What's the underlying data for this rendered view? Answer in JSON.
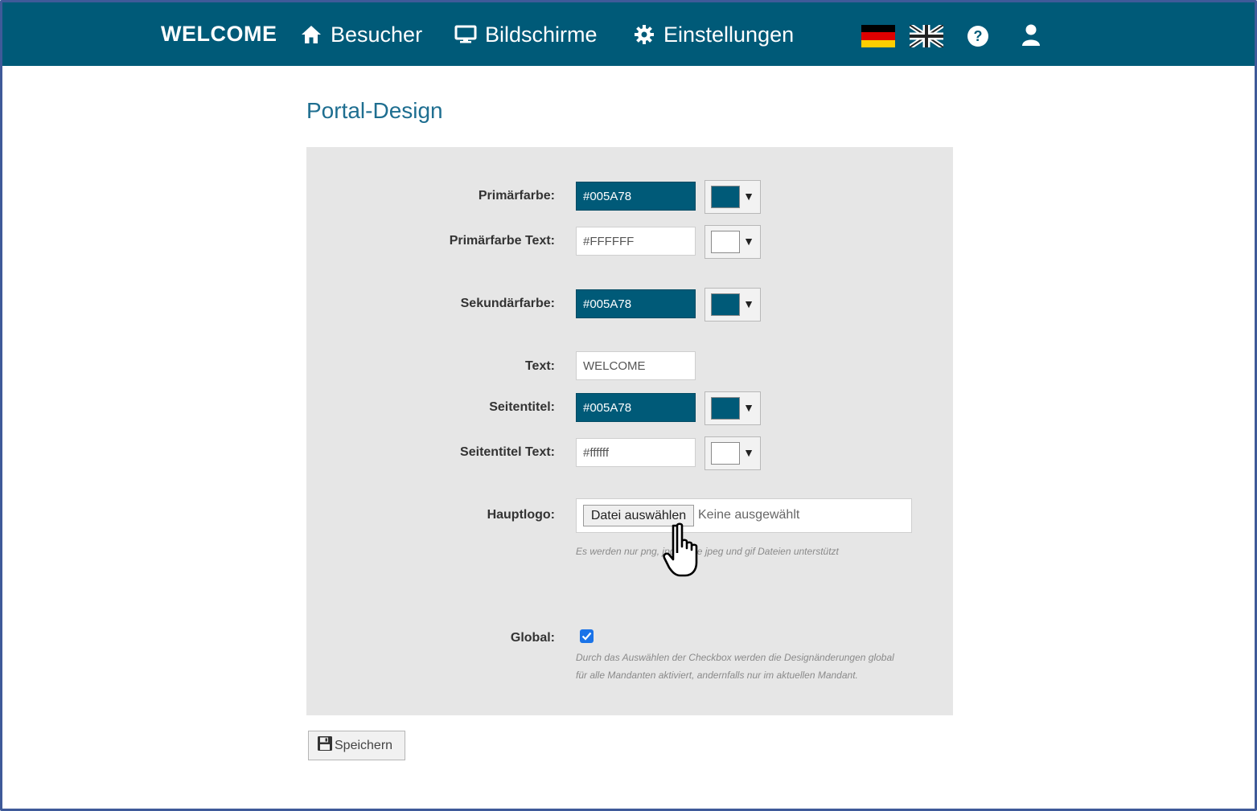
{
  "navbar": {
    "brand": "WELCOME",
    "items": [
      {
        "label": "Besucher",
        "icon": "home-icon"
      },
      {
        "label": "Bildschirme",
        "icon": "monitor-icon"
      },
      {
        "label": "Einstellungen",
        "icon": "gear-icon"
      }
    ],
    "languages": [
      "flag-de-icon",
      "flag-uk-icon"
    ],
    "help_icon": "help-icon",
    "user_icon": "user-icon",
    "bar_color": "#005A78"
  },
  "page": {
    "title": "Portal-Design"
  },
  "form": {
    "primary": {
      "label": "Primärfarbe:",
      "value": "#005A78",
      "swatch": "#005A78"
    },
    "primary_text": {
      "label": "Primärfarbe Text:",
      "value": "#FFFFFF",
      "swatch": "#FFFFFF"
    },
    "secondary": {
      "label": "Sekundärfarbe:",
      "value": "#005A78",
      "swatch": "#005A78"
    },
    "text": {
      "label": "Text:",
      "value": "WELCOME"
    },
    "page_title": {
      "label": "Seitentitel:",
      "value": "#005A78",
      "swatch": "#005A78"
    },
    "page_title_text": {
      "label": "Seitentitel Text:",
      "value": "#ffffff",
      "swatch": "#ffffff"
    },
    "logo": {
      "label": "Hauptlogo:",
      "button": "Datei auswählen",
      "status": "Keine ausgewählt",
      "hint": "Es werden nur png, jpg sowie jpeg und gif Dateien unterstützt"
    },
    "global": {
      "label": "Global:",
      "checked": true,
      "hint_line1": "Durch das Auswählen der Checkbox werden die Designänderungen global",
      "hint_line2": "für alle Mandanten aktiviert, andernfalls nur im aktuellen Mandant."
    }
  },
  "save_button": {
    "label": "Speichern",
    "icon": "floppy-disk-icon"
  }
}
